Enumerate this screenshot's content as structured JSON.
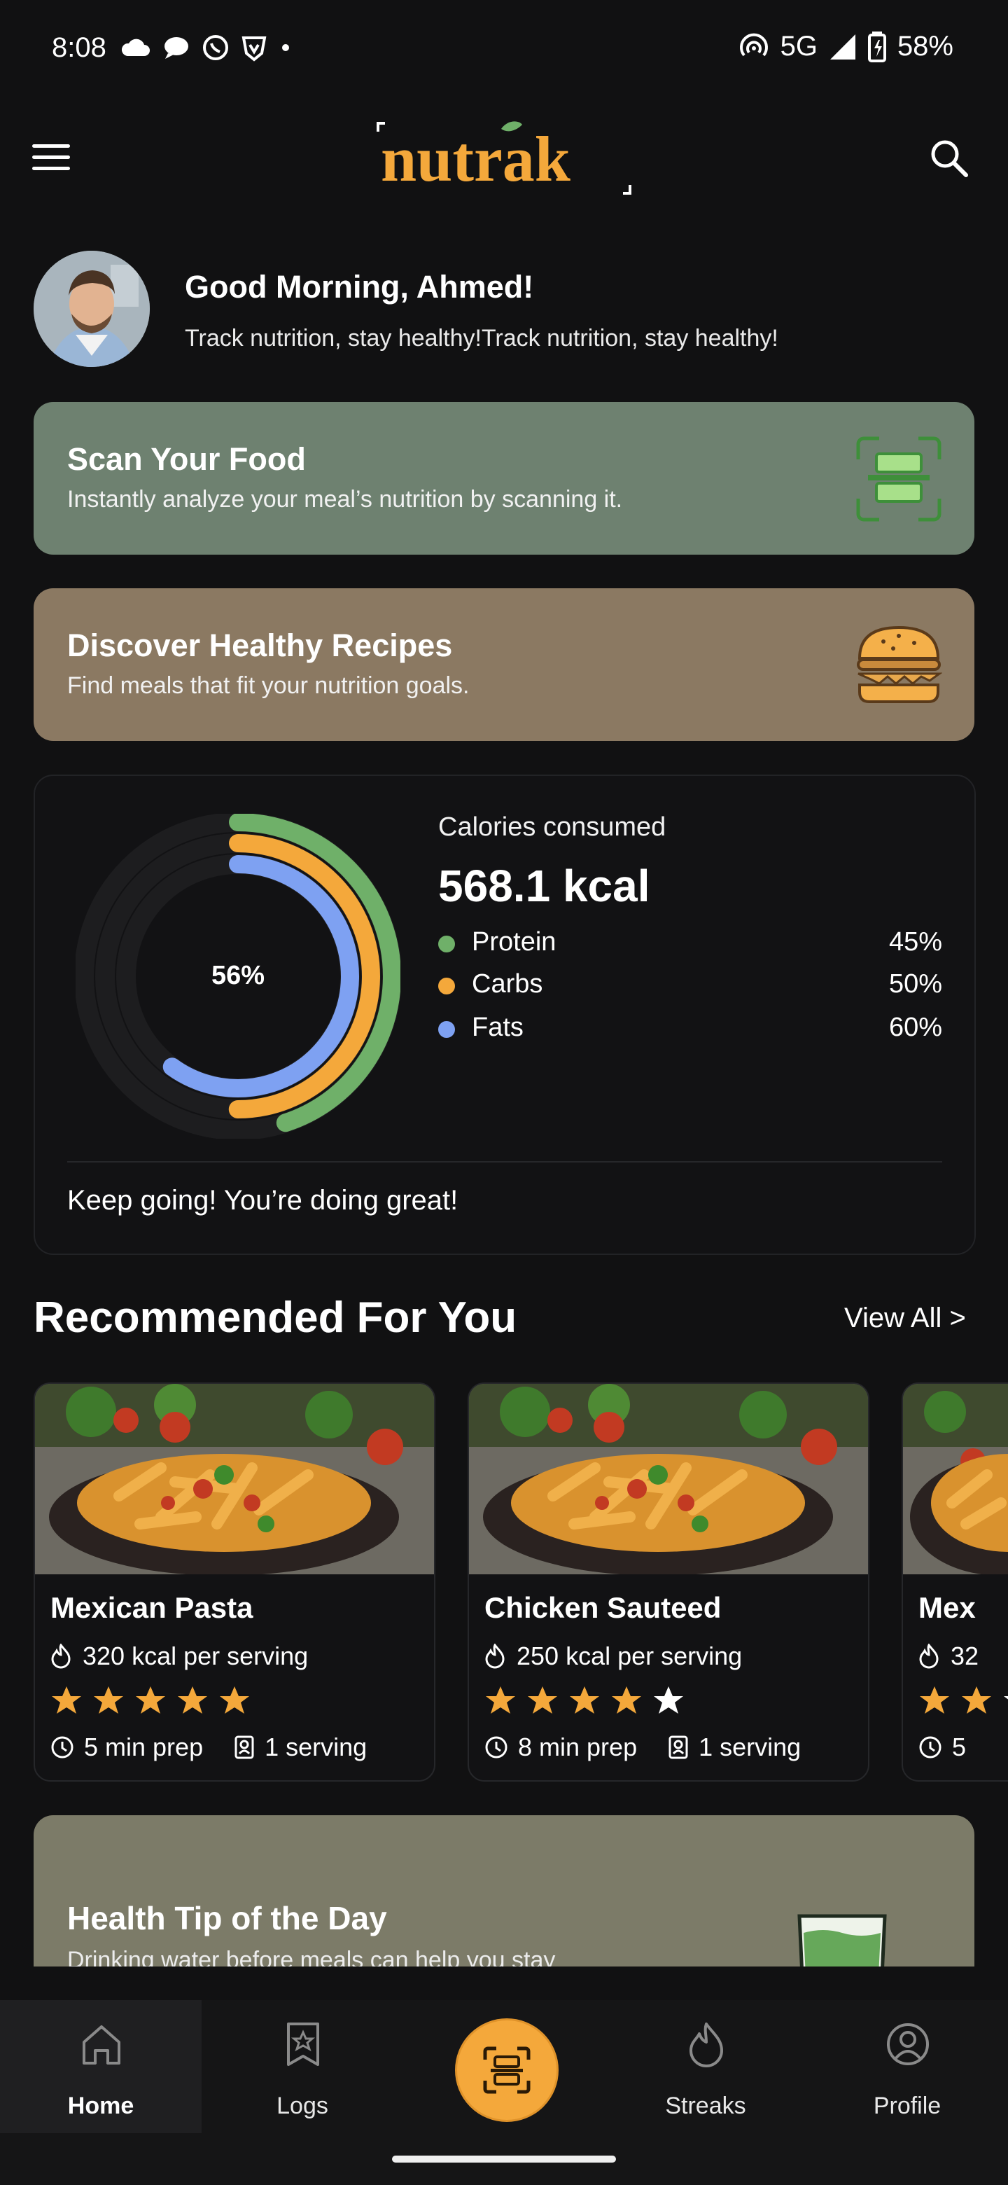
{
  "status_bar": {
    "time": "8:08",
    "network": "5G",
    "battery": "58%"
  },
  "header": {
    "logo_text": "nutrak",
    "menu_icon": "hamburger-icon",
    "search_icon": "search-icon"
  },
  "greeting": {
    "title": "Good Morning, Ahmed!",
    "subtitle": "Track nutrition, stay healthy!Track nutrition, stay healthy!"
  },
  "scan_card": {
    "title": "Scan Your Food",
    "subtitle": "Instantly analyze your meal’s nutrition by scanning it.",
    "icon": "scan-food-icon"
  },
  "recipes_card": {
    "title": "Discover Healthy Recipes",
    "subtitle": "Find meals that fit your nutrition goals.",
    "icon": "burger-icon"
  },
  "calories": {
    "label": "Calories consumed",
    "value": "568.1 kcal",
    "ring_center": "56%",
    "macros": [
      {
        "name": "Protein",
        "percent": "45%",
        "color": "#6fb069",
        "fraction": 0.45
      },
      {
        "name": "Carbs",
        "percent": "50%",
        "color": "#f4a83b",
        "fraction": 0.5
      },
      {
        "name": "Fats",
        "percent": "60%",
        "color": "#7ea1f2",
        "fraction": 0.6
      }
    ],
    "footer": "Keep going! You’re doing great!"
  },
  "recommended": {
    "title": "Recommended For You",
    "view_all": "View All  >",
    "items": [
      {
        "name": "Mexican Pasta",
        "kcal": "320 kcal per serving",
        "rating": 5,
        "prep": "5 min prep",
        "serving": "1 serving"
      },
      {
        "name": "Chicken Sauteed",
        "kcal": "250 kcal per serving",
        "rating": 4,
        "prep": "8 min prep",
        "serving": "1 serving"
      },
      {
        "name": "Mex",
        "kcal": "32",
        "rating": 2,
        "prep": "5",
        "serving": ""
      }
    ]
  },
  "health_tip": {
    "title": "Health Tip of the Day",
    "subtitle": "Drinking water before meals can help you stay"
  },
  "bottom_nav": {
    "items": [
      {
        "label": "Home",
        "icon": "home-icon",
        "active": true
      },
      {
        "label": "Logs",
        "icon": "logs-icon",
        "active": false
      },
      {
        "label": "Streaks",
        "icon": "flame-icon",
        "active": false
      },
      {
        "label": "Profile",
        "icon": "profile-icon",
        "active": false
      }
    ],
    "center_button_icon": "scan-icon"
  },
  "colors": {
    "background": "#111112",
    "accent": "#f4a83b",
    "scan_card": "#6e8170",
    "recipes_card": "#8b7962",
    "tip_card": "#7c7b68"
  }
}
